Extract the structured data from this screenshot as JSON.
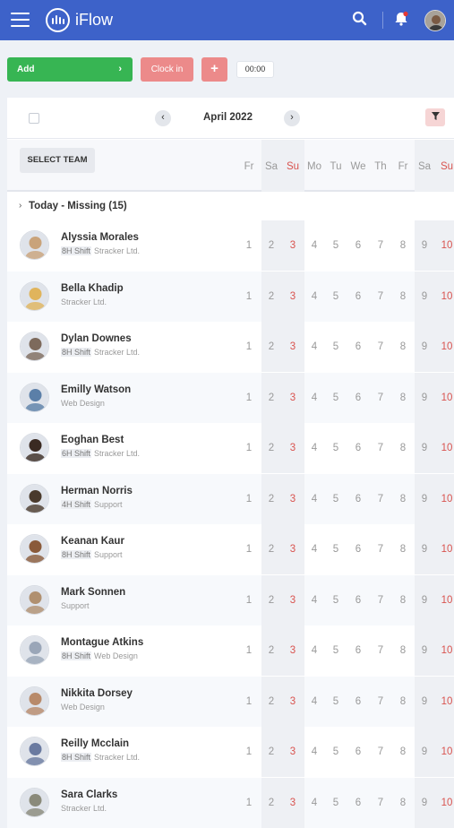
{
  "app": {
    "brand": "iFlow"
  },
  "toolbar": {
    "add_label": "Add",
    "add_arrow": "›",
    "clock_label": "Clock in",
    "plus_label": "+",
    "timer": "00:00"
  },
  "calendar": {
    "month": "April 2022",
    "prev": "‹",
    "next": "›",
    "filter_icon": "funnel-icon",
    "select_team": "SELECT TEAM",
    "days": [
      "Fr",
      "Sa",
      "Su",
      "Mo",
      "Tu",
      "We",
      "Th",
      "Fr",
      "Sa",
      "Su"
    ],
    "dates": [
      "1",
      "2",
      "3",
      "4",
      "5",
      "6",
      "7",
      "8",
      "9",
      "10"
    ]
  },
  "group": {
    "label": "Today - Missing (15)"
  },
  "colors": {
    "header": "#3d62c9",
    "add": "#37b553",
    "clock": "#ec8a8a",
    "sunday": "#d9534f"
  },
  "employees": [
    {
      "name": "Alyssia Morales",
      "shift": "8H Shift",
      "team": "Stracker Ltd.",
      "avatar": "#c9a37a"
    },
    {
      "name": "Bella Khadip",
      "shift": "",
      "team": "Stracker Ltd.",
      "avatar": "#e0b45c"
    },
    {
      "name": "Dylan Downes",
      "shift": "8H Shift",
      "team": "Stracker Ltd.",
      "avatar": "#7d6a5c"
    },
    {
      "name": "Emilly Watson",
      "shift": "",
      "team": "Web Design",
      "avatar": "#5b7fa8"
    },
    {
      "name": "Eoghan Best",
      "shift": "6H Shift",
      "team": "Stracker Ltd.",
      "avatar": "#3a2a22"
    },
    {
      "name": "Herman Norris",
      "shift": "4H Shift",
      "team": "Support",
      "avatar": "#4a3a2c"
    },
    {
      "name": "Keanan Kaur",
      "shift": "8H Shift",
      "team": "Support",
      "avatar": "#8a5a3a"
    },
    {
      "name": "Mark Sonnen",
      "shift": "",
      "team": "Support",
      "avatar": "#b09070"
    },
    {
      "name": "Montague Atkins",
      "shift": "8H Shift",
      "team": "Web Design",
      "avatar": "#9aa6b8"
    },
    {
      "name": "Nikkita Dorsey",
      "shift": "",
      "team": "Web Design",
      "avatar": "#b88a6a"
    },
    {
      "name": "Reilly Mcclain",
      "shift": "8H Shift",
      "team": "Stracker Ltd.",
      "avatar": "#6a7aa0"
    },
    {
      "name": "Sara Clarks",
      "shift": "",
      "team": "Stracker Ltd.",
      "avatar": "#8a8a7a"
    }
  ]
}
